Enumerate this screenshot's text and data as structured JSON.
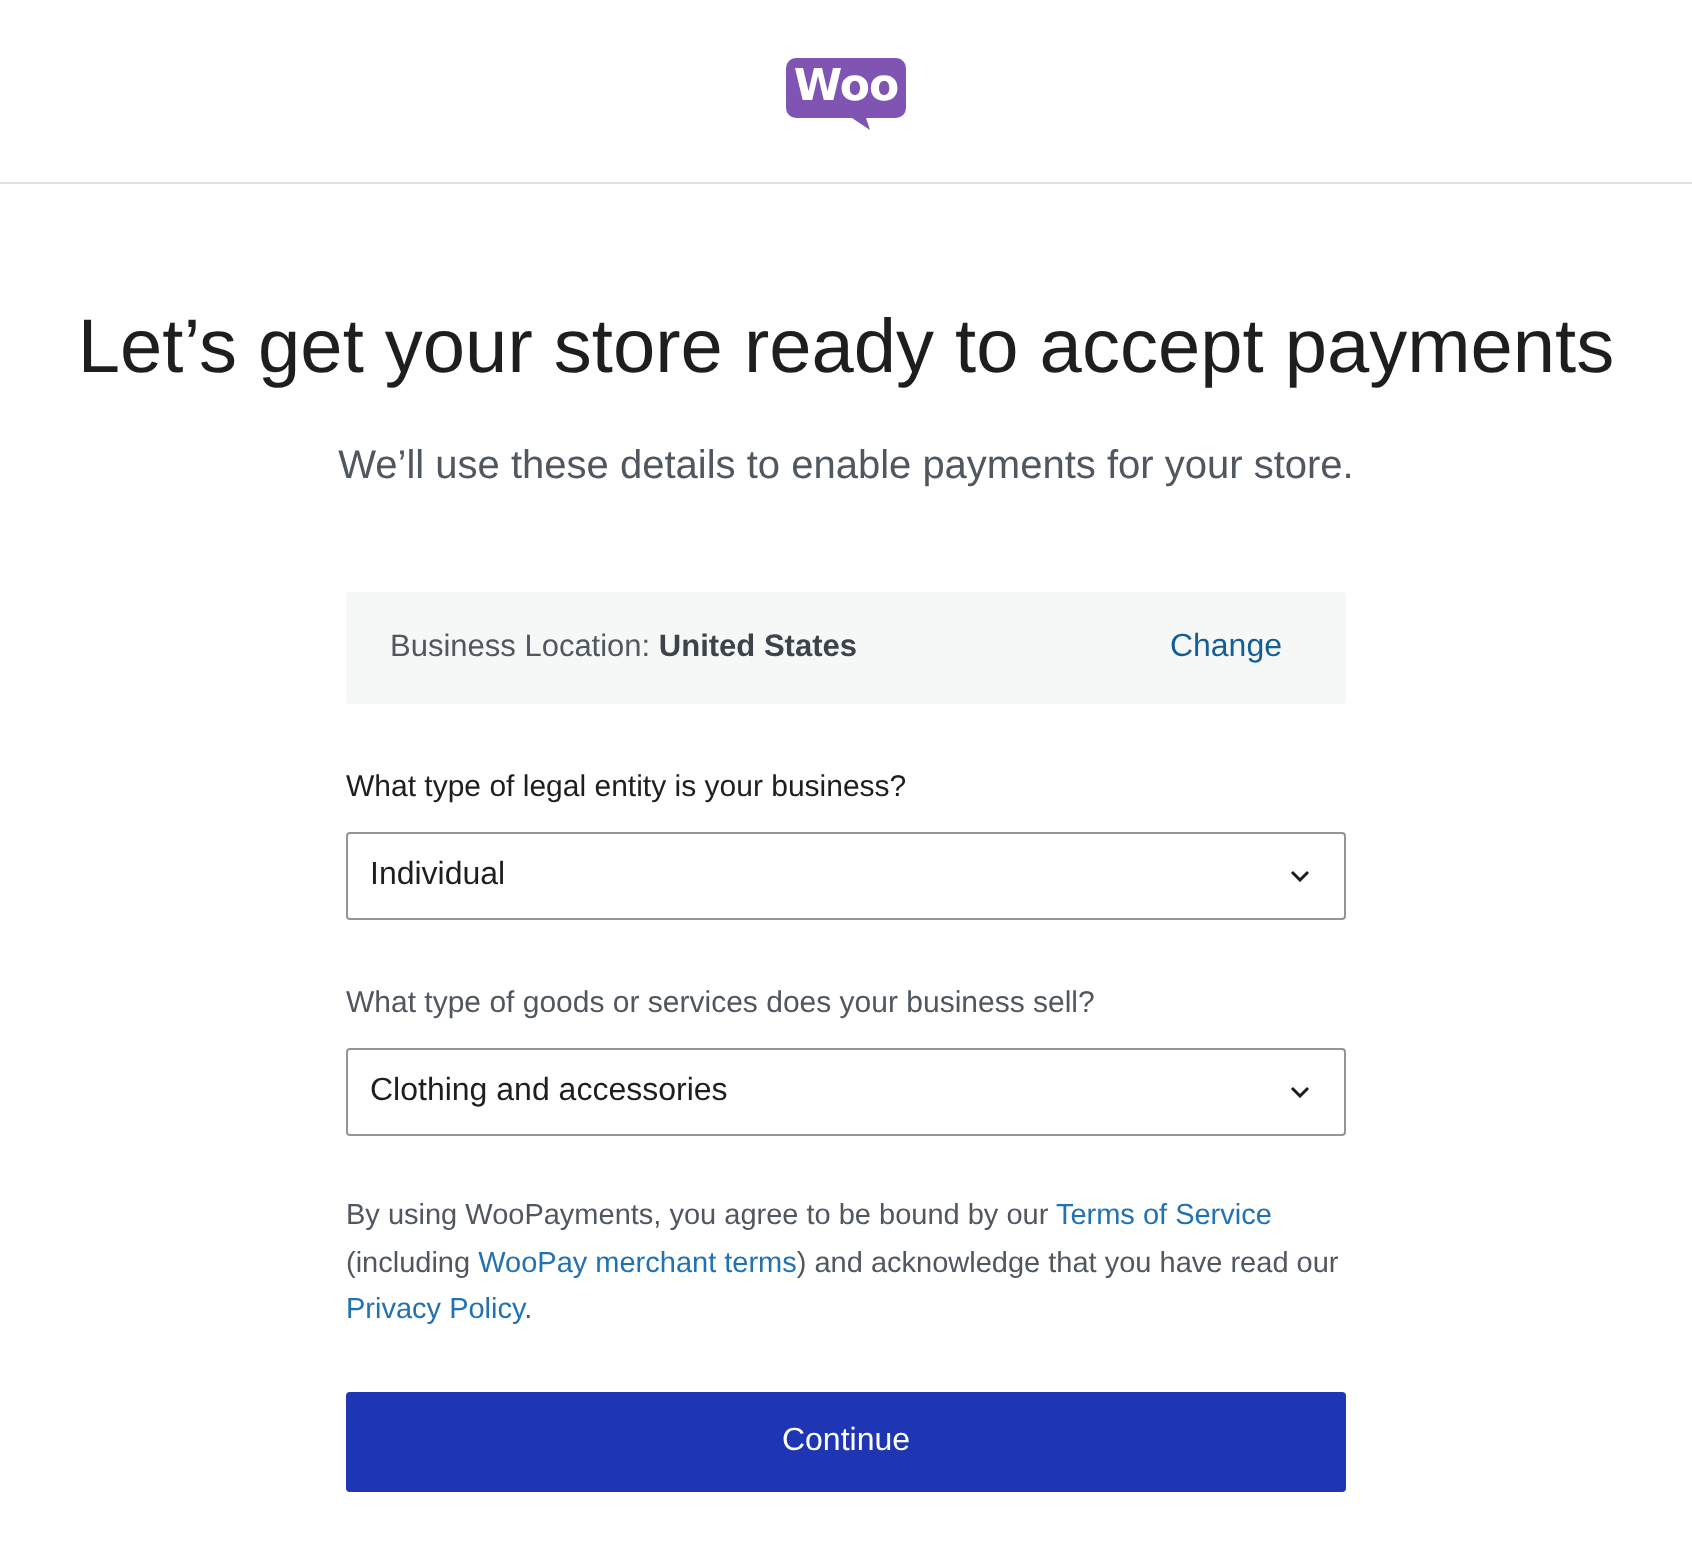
{
  "header": {
    "logo": "Woo"
  },
  "title": "Let’s get your store ready to accept payments",
  "subtitle": "We’ll use these details to enable payments for your store.",
  "location": {
    "text": "Business Location: **United States**",
    "action": "Change"
  },
  "fields": [
    {
      "label": "What type of legal entity is your business?",
      "value": "Individual",
      "focused": true
    },
    {
      "label": "What type of goods or services does your business sell?",
      "value": "Clothing and accessories",
      "focused": false
    }
  ],
  "legal": [
    {
      "kind": "text",
      "text": "By using WooPayments, you agree to be bound by our "
    },
    {
      "kind": "link",
      "text": "Terms of Service"
    },
    {
      "kind": "text",
      "text": " (including "
    },
    {
      "kind": "link",
      "text": "WooPay merchant terms"
    },
    {
      "kind": "text",
      "text": ") and acknowledge that you have read our "
    },
    {
      "kind": "link",
      "text": "Privacy Policy"
    },
    {
      "kind": "text",
      "text": "."
    }
  ],
  "button": "Continue"
}
